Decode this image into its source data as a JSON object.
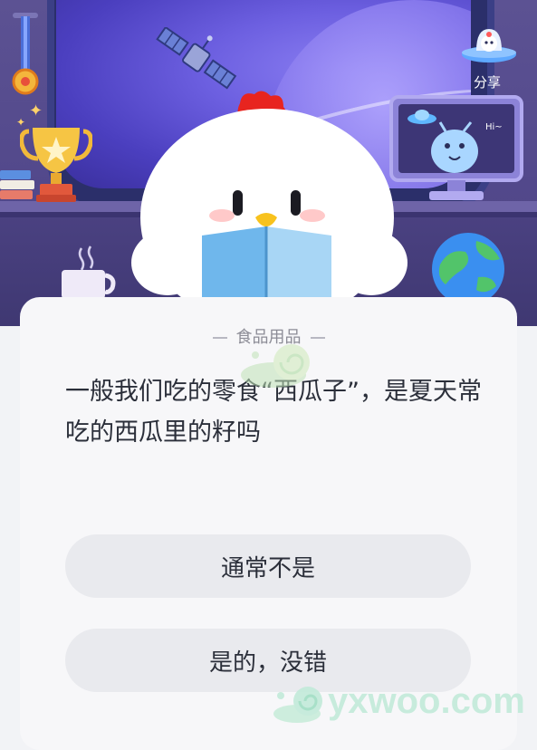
{
  "header": {
    "share_label": "分享",
    "monitor_text": "Hi~"
  },
  "card": {
    "category": "食品用品",
    "question": "一般我们吃的零食“西瓜子”，是夏天常吃的西瓜里的籽吗",
    "options": [
      {
        "label": "通常不是"
      },
      {
        "label": "是的，没错"
      }
    ]
  },
  "watermark": {
    "text": "yxwoo.com"
  },
  "colors": {
    "header_bg": "#51478a",
    "card_bg": "#f7f7f9",
    "option_bg": "#e9eaee",
    "text_primary": "#2b2f3a",
    "text_muted": "#8c8c96",
    "watermark": "#bfead8"
  }
}
